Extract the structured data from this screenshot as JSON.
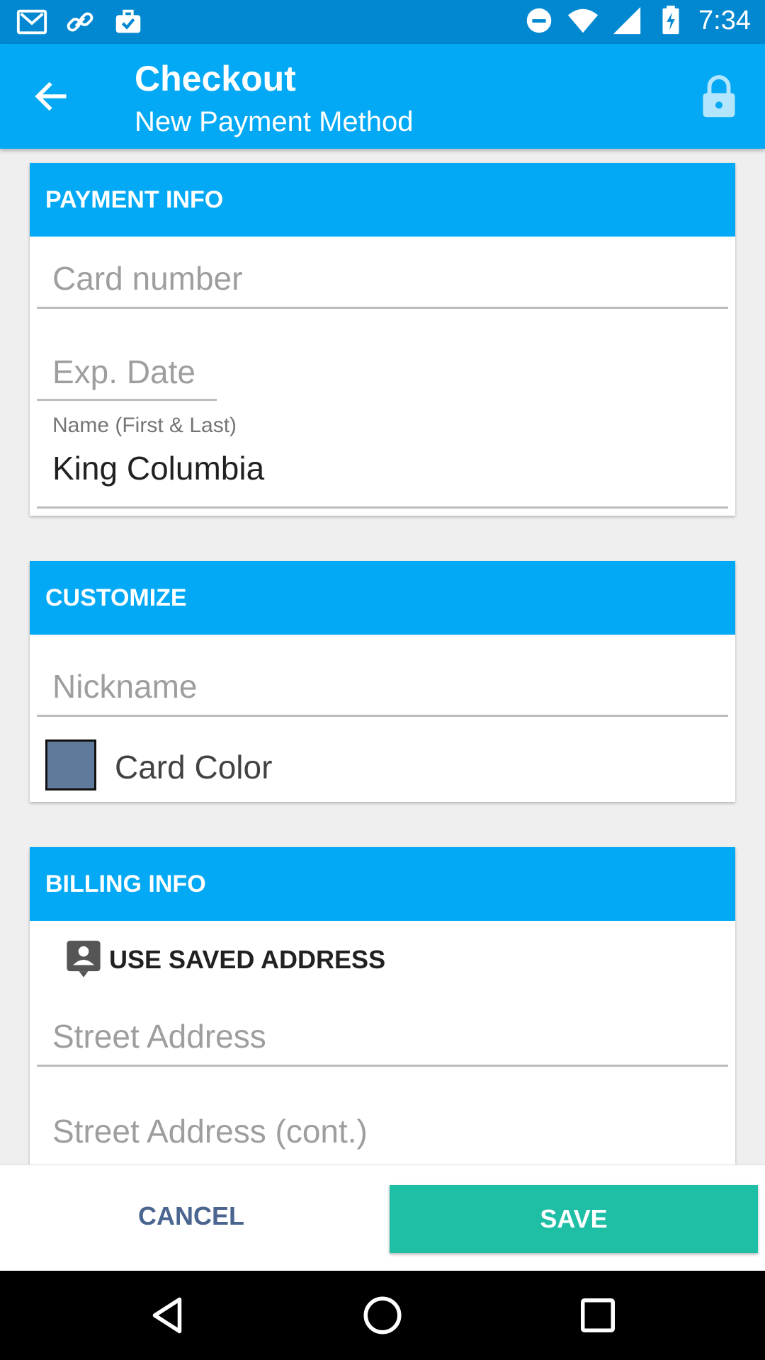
{
  "status_bar": {
    "time": "7:34",
    "left_icons": [
      "gmail-icon",
      "link-icon",
      "briefcase-check-icon"
    ],
    "right_icons": [
      "do-not-disturb-icon",
      "wifi-icon",
      "signal-icon",
      "battery-charging-icon"
    ]
  },
  "app_bar": {
    "title": "Checkout",
    "subtitle": "New Payment Method",
    "back_icon": "arrow-back-icon",
    "lock_icon": "lock-icon"
  },
  "payment_info": {
    "header": "PAYMENT INFO",
    "card_number": {
      "placeholder": "Card number",
      "value": ""
    },
    "exp_date": {
      "placeholder": "Exp. Date",
      "value": ""
    },
    "name": {
      "label": "Name (First & Last)",
      "value": "King Columbia"
    }
  },
  "customize": {
    "header": "CUSTOMIZE",
    "nickname": {
      "placeholder": "Nickname",
      "value": ""
    },
    "card_color": {
      "label": "Card Color",
      "color": "#607a9c"
    }
  },
  "billing_info": {
    "header": "BILLING INFO",
    "use_saved_address": "USE SAVED ADDRESS",
    "street_address": {
      "placeholder": "Street Address",
      "value": ""
    },
    "street_address_cont": {
      "placeholder": "Street Address (cont.)",
      "value": ""
    }
  },
  "actions": {
    "cancel": "CANCEL",
    "save": "SAVE"
  },
  "colors": {
    "primary": "#03a9f4",
    "primary_dark": "#0288d1",
    "accent": "#1ebfa5",
    "cancel_text": "#4a6590"
  }
}
